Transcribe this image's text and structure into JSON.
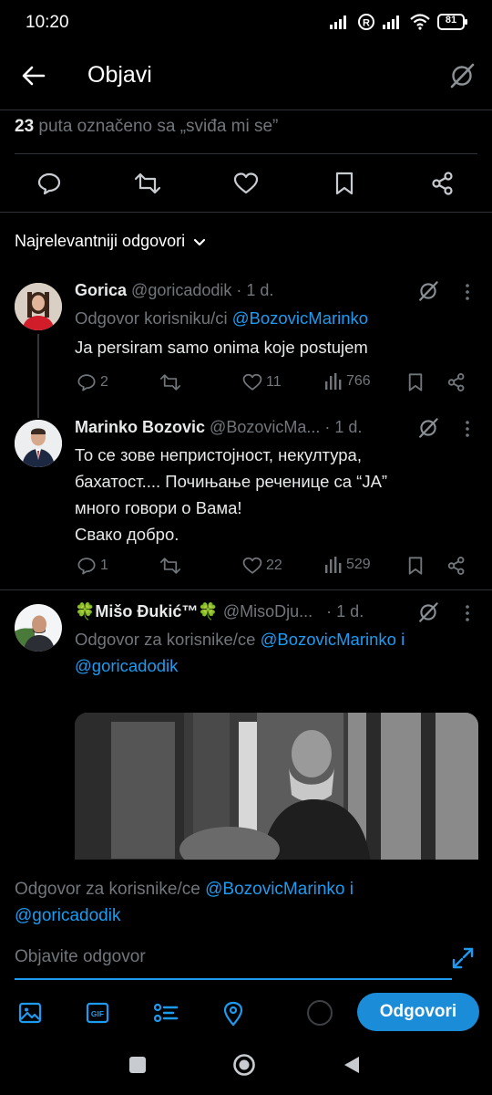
{
  "status_bar": {
    "time": "10:20",
    "battery": "81"
  },
  "header": {
    "title": "Objavi"
  },
  "likes": {
    "count": "23",
    "text": "puta označeno sa „sviđa mi se”"
  },
  "sort": {
    "label": "Najrelevantniji odgovori"
  },
  "replies": [
    {
      "name": "Gorica",
      "handle": "@goricadodik",
      "time": "· 1 d.",
      "reply_prefix": "Odgovor korisniku/ci",
      "reply_mentions": "@BozovicMarinko",
      "text": "Ja persiram samo onima koje postujem",
      "replies": "2",
      "likes": "11",
      "views": "766"
    },
    {
      "name": "Marinko Bozovic",
      "handle": "@BozovicMa...",
      "time": "· 1 d.",
      "text_lines": [
        "То се зове непристојност, некултура,",
        "бахатост.... Почињање реченице са “JA”",
        "много говори о Вама!",
        "Свако добро."
      ],
      "replies": "1",
      "likes": "22",
      "views": "529"
    },
    {
      "name": "🍀Mišo Đukić™🍀",
      "handle": "@MisoDju...",
      "time": "· 1 d.",
      "reply_prefix": "Odgovor za korisnike/ce",
      "reply_mention_1": "@BozovicMarinko",
      "reply_joiner": "i",
      "reply_mention_2": "@goricadodik"
    }
  ],
  "compose": {
    "reply_prefix": "Odgovor za korisnike/ce",
    "mention_1": "@BozovicMarinko",
    "joiner": "i",
    "mention_2": "@goricadodik",
    "placeholder": "Objavite odgovor",
    "reply_button": "Odgovori"
  },
  "colors": {
    "accent": "#1d9bf0",
    "muted": "#71767b",
    "background": "#000000"
  }
}
